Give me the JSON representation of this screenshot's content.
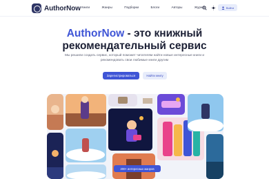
{
  "header": {
    "logo_text": "AuthorNow",
    "nav": [
      "Книги",
      "Жанры",
      "Подборки",
      "Блоги",
      "Авторы",
      "Журнал"
    ],
    "login_label": "Войти",
    "icons": [
      "search-icon",
      "theme-toggle-icon",
      "user-icon"
    ]
  },
  "hero": {
    "brand": "AuthorNow",
    "title_rest_line1": " - это книжный",
    "title_line2": "рекомендательный сервис",
    "subtitle": "Мы решили создать сервис, который поможет читателям найти новые интересные книги и рекомендовать свои любимые книги другим",
    "primary_button": "Зарегистрироваться",
    "secondary_button": "Найти книгу"
  },
  "gallery": {
    "badge": "200+ интересных жанров",
    "colors": {
      "sky": "#9fd0f0",
      "night": "#1b2356",
      "sunset": "#f2b37a",
      "purple": "#6b4bd8",
      "accent": "#3f55d6"
    }
  }
}
